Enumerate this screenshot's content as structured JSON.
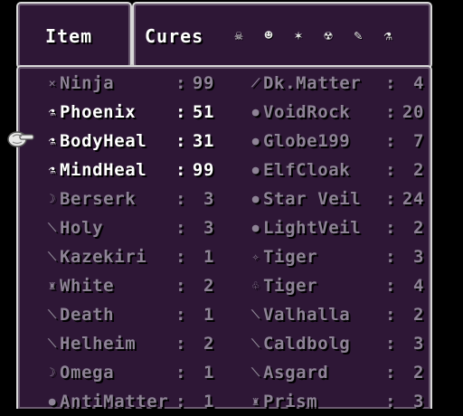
{
  "header": {
    "item_label": "Item",
    "cures_label": "Cures",
    "status_icons": [
      "poison-icon",
      "zombie-icon",
      "petrify-icon",
      "skull-icon",
      "feather-icon",
      "potion-icon"
    ]
  },
  "items_left": [
    {
      "icon": "star-icon",
      "name": "Ninja",
      "sep": ":",
      "qty": "99",
      "active": false
    },
    {
      "icon": "potion-icon",
      "name": "Phoenix",
      "sep": ":",
      "qty": "51",
      "active": true
    },
    {
      "icon": "potion-icon",
      "name": "BodyHeal",
      "sep": ":",
      "qty": "31",
      "active": true
    },
    {
      "icon": "potion-icon",
      "name": "MindHeal",
      "sep": ":",
      "qty": "99",
      "active": true
    },
    {
      "icon": "bow-icon",
      "name": "Berserk",
      "sep": ":",
      "qty": "3",
      "active": false
    },
    {
      "icon": "sword-icon",
      "name": "Holy",
      "sep": ":",
      "qty": "3",
      "active": false
    },
    {
      "icon": "katana-icon",
      "name": "Kazekiri",
      "sep": ":",
      "qty": "1",
      "active": false
    },
    {
      "icon": "armor-icon",
      "name": "White",
      "sep": ":",
      "qty": "2",
      "active": false
    },
    {
      "icon": "sword-icon",
      "name": "Death",
      "sep": ":",
      "qty": "1",
      "active": false
    },
    {
      "icon": "sword-icon",
      "name": "Helheim",
      "sep": ":",
      "qty": "2",
      "active": false
    },
    {
      "icon": "bow-icon",
      "name": "Omega",
      "sep": ":",
      "qty": "1",
      "active": false
    },
    {
      "icon": "orb-icon",
      "name": "AntiMatter",
      "sep": ":",
      "qty": "1",
      "active": false
    }
  ],
  "items_right": [
    {
      "icon": "dagger-icon",
      "name": "Dk.Matter",
      "sep": ":",
      "qty": "4",
      "active": false
    },
    {
      "icon": "orb-icon",
      "name": "VoidRock",
      "sep": ":",
      "qty": "20",
      "active": false
    },
    {
      "icon": "orb-icon",
      "name": "Globe199",
      "sep": ":",
      "qty": "7",
      "active": false
    },
    {
      "icon": "orb-icon",
      "name": "ElfCloak",
      "sep": ":",
      "qty": "2",
      "active": false
    },
    {
      "icon": "orb-icon",
      "name": "Star Veil",
      "sep": ":",
      "qty": "24",
      "active": false
    },
    {
      "icon": "orb-icon",
      "name": "LightVeil",
      "sep": ":",
      "qty": "2",
      "active": false
    },
    {
      "icon": "bomb-icon",
      "name": "Tiger",
      "sep": ":",
      "qty": "3",
      "active": false
    },
    {
      "icon": "claw-icon",
      "name": "Tiger",
      "sep": ":",
      "qty": "4",
      "active": false
    },
    {
      "icon": "sword-icon",
      "name": "Valhalla",
      "sep": ":",
      "qty": "2",
      "active": false
    },
    {
      "icon": "sword-icon",
      "name": "Caldbolg",
      "sep": ":",
      "qty": "3",
      "active": false
    },
    {
      "icon": "sword-icon",
      "name": "Asgard",
      "sep": ":",
      "qty": "2",
      "active": false
    },
    {
      "icon": "armor-icon",
      "name": "Prism",
      "sep": ":",
      "qty": "3",
      "active": false
    }
  ],
  "selected_item": "BodyHeal",
  "colors": {
    "window_bg": "#2e1736",
    "border": "#d8d8d8",
    "text_active": "#ffffff",
    "text_inactive": "#8e8396"
  }
}
